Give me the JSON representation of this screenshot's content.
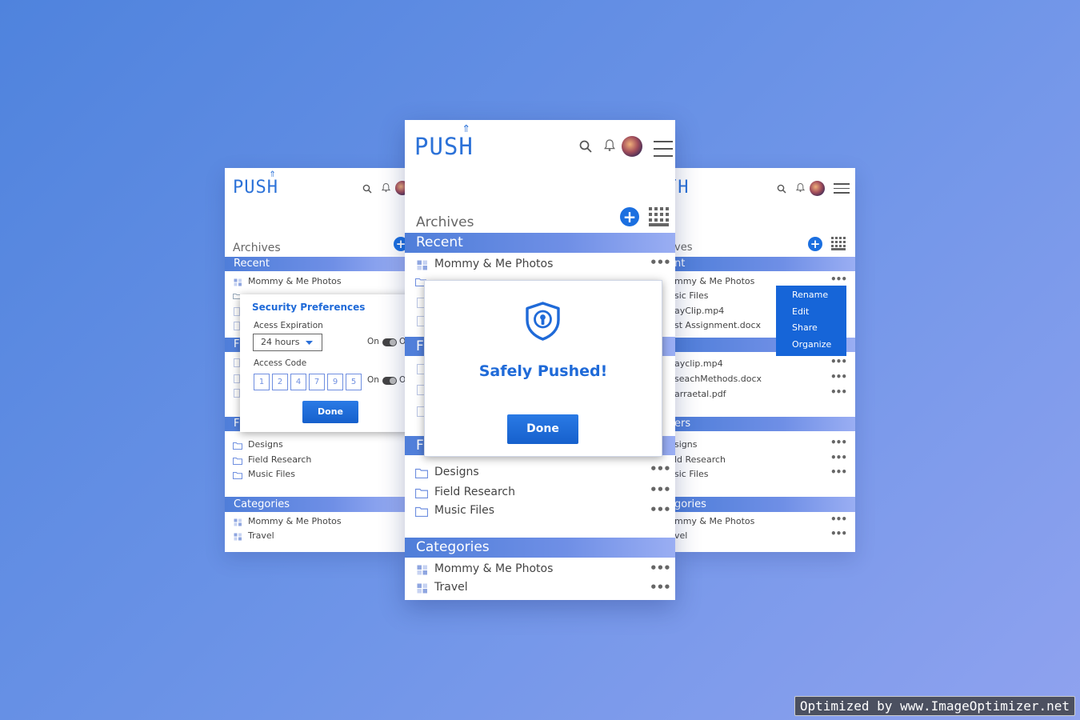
{
  "brand": {
    "logo_text": "PUSH",
    "logo_arrow": "⇑"
  },
  "icons": [
    "search-icon",
    "bell-icon",
    "avatar",
    "hamburger-icon",
    "plus-icon",
    "grid-icon",
    "folder-icon",
    "file-icon",
    "category-icon",
    "shield-lock-icon",
    "more-icon"
  ],
  "colors": {
    "accent": "#1b6fe0",
    "band_start": "#4f7ed9",
    "band_end": "#9aaef3",
    "background": "#5e8ce3"
  },
  "center": {
    "archives": "Archives",
    "recent_label": "Recent",
    "recent_first": "Mommy & Me Photos",
    "partial_header_letter": "F",
    "folders": [
      "Designs",
      "Field Research",
      "Music Files"
    ],
    "categories_label": "Categories",
    "categories": [
      "Mommy & Me Photos",
      "Travel"
    ],
    "more": "•••",
    "dialog": {
      "title": "Safely Pushed!",
      "button": "Done"
    }
  },
  "left": {
    "archives": "Archives",
    "recent_label": "Recent",
    "recent_first": "Mommy & Me Photos",
    "partial_header_letter": "F",
    "folders": [
      "Designs",
      "Field Research",
      "Music Files"
    ],
    "categories_label": "Categories",
    "categories": [
      "Mommy & Me Photos",
      "Travel"
    ],
    "security": {
      "title": "Security Preferences",
      "expiration_label": "Acess Expiration",
      "expiration_value": "24 hours",
      "on_label": "On",
      "toggle_tail": "O",
      "code_label": "Access Code",
      "code_digits": [
        "1",
        "2",
        "4",
        "7",
        "9",
        "5"
      ],
      "button": "Done"
    }
  },
  "right": {
    "archives_tail": "ves",
    "recent_tail": "nt",
    "recent_items": [
      "mmy & Me Photos",
      "sic Files",
      "ayClip.mp4",
      "st Assignment.docx"
    ],
    "files_items": [
      "ayclip.mp4",
      "seachMethods.docx",
      "arraetal.pdf"
    ],
    "folders_tail": "ers",
    "folders": [
      "signs",
      "ld Research",
      "sic Files"
    ],
    "categories_tail": "gories",
    "categories": [
      "mmy & Me Photos",
      "vel"
    ],
    "context_menu": [
      "Rename",
      "Edit",
      "Share",
      "Organize"
    ]
  },
  "watermark": "Optimized by www.ImageOptimizer.net"
}
